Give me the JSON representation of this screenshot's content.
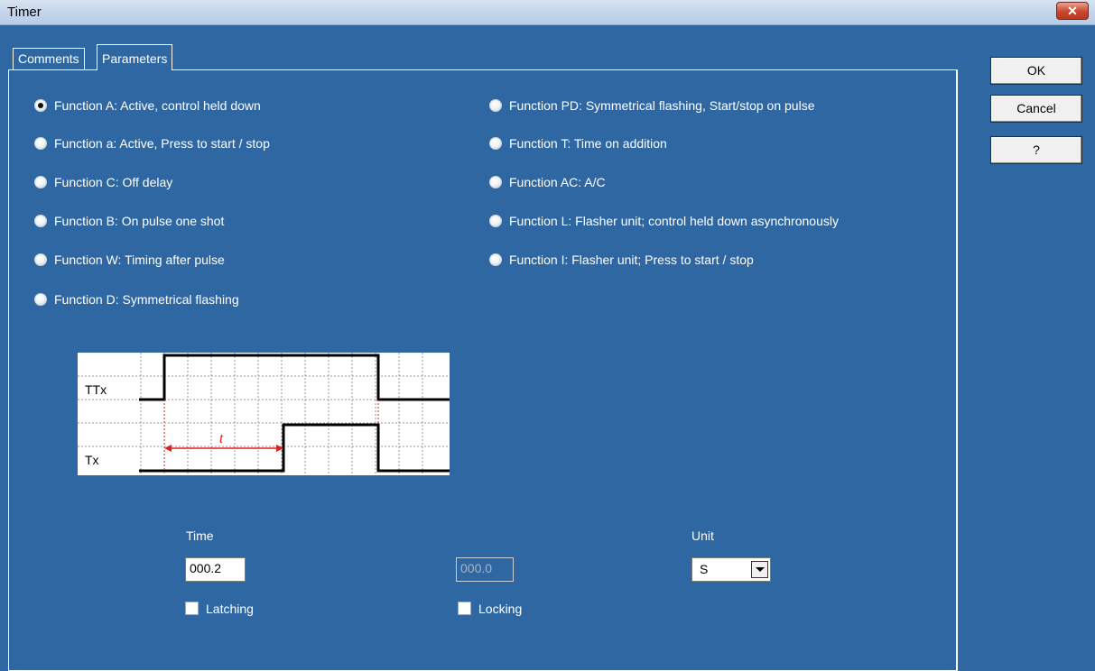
{
  "window": {
    "title": "Timer",
    "close_icon": "close-icon"
  },
  "tabs": [
    {
      "label": "Comments",
      "active": false
    },
    {
      "label": "Parameters",
      "active": true
    }
  ],
  "functions_left": [
    {
      "label": "Function A: Active, control held down",
      "checked": true
    },
    {
      "label": "Function a: Active, Press to start / stop",
      "checked": false
    },
    {
      "label": "Function C: Off delay",
      "checked": false
    },
    {
      "label": "Function B: On pulse one shot",
      "checked": false
    },
    {
      "label": "Function W: Timing after pulse",
      "checked": false
    },
    {
      "label": "Function D: Symmetrical flashing",
      "checked": false
    }
  ],
  "functions_right": [
    {
      "label": "Function PD: Symmetrical flashing, Start/stop on pulse",
      "checked": false
    },
    {
      "label": "Function T: Time on addition",
      "checked": false
    },
    {
      "label": "Function AC: A/C",
      "checked": false
    },
    {
      "label": "Function L: Flasher unit; control held down asynchronously",
      "checked": false
    },
    {
      "label": "Function I: Flasher unit; Press to start / stop",
      "checked": false
    }
  ],
  "diagram": {
    "signal_top": "TTx",
    "signal_bottom": "Tx",
    "interval_label": "t",
    "accent_color": "#e02020"
  },
  "time": {
    "label": "Time",
    "value": "000.2"
  },
  "time2": {
    "value": "000.0",
    "disabled": true
  },
  "unit": {
    "label": "Unit",
    "value": "S"
  },
  "latching": {
    "label": "Latching",
    "checked": false
  },
  "locking": {
    "label": "Locking",
    "checked": false
  },
  "buttons": {
    "ok": "OK",
    "cancel": "Cancel",
    "help": "?"
  }
}
